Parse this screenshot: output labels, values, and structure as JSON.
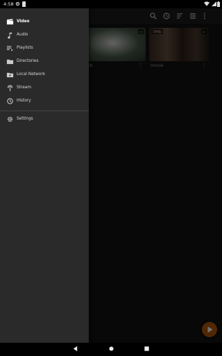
{
  "status_bar": {
    "time": "4:58"
  },
  "toolbar": {
    "icons": [
      "search-icon",
      "history-icon",
      "sort-icon",
      "list-view-icon",
      "more-vert-icon"
    ]
  },
  "videos": [
    {
      "title": "bb",
      "resolution": ""
    },
    {
      "title": "movie",
      "resolution": "1080p"
    }
  ],
  "drawer": {
    "items": [
      {
        "label": "Video",
        "icon": "video-clapper-icon",
        "active": true
      },
      {
        "label": "Audio",
        "icon": "music-note-icon"
      },
      {
        "label": "Playlists",
        "icon": "playlist-icon"
      },
      {
        "label": "Directories",
        "icon": "folder-icon"
      },
      {
        "label": "Local Network",
        "icon": "network-folder-icon"
      },
      {
        "label": "Stream",
        "icon": "stream-antenna-icon"
      },
      {
        "label": "History",
        "icon": "history-icon"
      }
    ],
    "settings": {
      "label": "Settings",
      "icon": "gear-icon"
    }
  },
  "colors": {
    "accent": "#b3570a",
    "drawer_bg": "#2a2a2a"
  }
}
